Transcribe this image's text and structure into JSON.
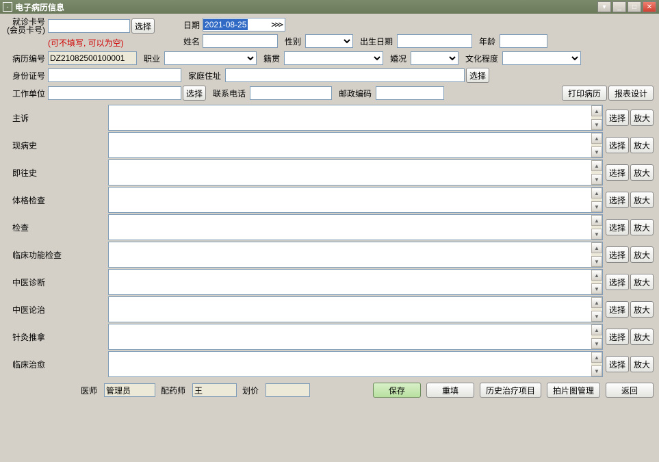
{
  "window": {
    "title": "电子病历信息"
  },
  "header": {
    "card_label": "就诊卡号\n(会员卡号)",
    "card_value": "",
    "select_btn": "选择",
    "hint": "(可不填写, 可以为空)",
    "date_label": "日期",
    "date_value": "2021-08-25",
    "name_label": "姓名",
    "name_value": "",
    "sex_label": "性别",
    "birth_label": "出生日期",
    "birth_value": "",
    "age_label": "年龄",
    "age_value": "",
    "record_no_label": "病历编号",
    "record_no_value": "DZ21082500100001",
    "job_label": "职业",
    "native_label": "籍贯",
    "marriage_label": "婚况",
    "edu_label": "文化程度",
    "id_label": "身份证号",
    "id_value": "",
    "addr_label": "家庭住址",
    "addr_value": "",
    "addr_select": "选择",
    "work_label": "工作单位",
    "work_value": "",
    "work_select": "选择",
    "phone_label": "联系电话",
    "phone_value": "",
    "postal_label": "邮政编码",
    "postal_value": "",
    "print_btn": "打印病历",
    "design_btn": "报表设计"
  },
  "sections": [
    {
      "label": "主诉"
    },
    {
      "label": "现病史"
    },
    {
      "label": "即往史"
    },
    {
      "label": "体格检查"
    },
    {
      "label": "检查"
    },
    {
      "label": "临床功能检查"
    },
    {
      "label": "中医诊断"
    },
    {
      "label": "中医论治"
    },
    {
      "label": "针灸推拿"
    },
    {
      "label": "临床治愈"
    }
  ],
  "section_btns": {
    "select": "选择",
    "zoom": "放大"
  },
  "footer": {
    "doctor_label": "医师",
    "doctor_value": "管理员",
    "pharm_label": "配药师",
    "pharm_value": "王",
    "price_label": "划价",
    "price_value": "",
    "save": "保存",
    "reset": "重填",
    "history": "历史治疗项目",
    "photo": "拍片图管理",
    "back": "返回"
  }
}
